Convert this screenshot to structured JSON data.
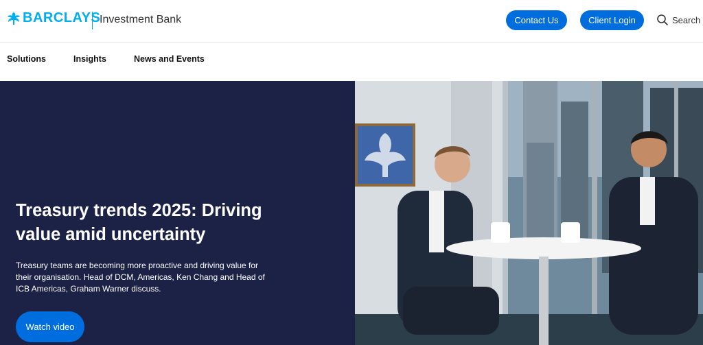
{
  "header": {
    "brand": "BARCLAYS",
    "unit": "Investment Bank",
    "contact_label": "Contact Us",
    "login_label": "Client Login",
    "search_label": "Search"
  },
  "nav": {
    "items": [
      {
        "label": "Solutions"
      },
      {
        "label": "Insights"
      },
      {
        "label": "News and Events"
      }
    ]
  },
  "hero": {
    "title": "Treasury trends 2025: Driving value amid uncertainty",
    "description": "Treasury teams are becoming more proactive and driving value for their organisation. Head of DCM, Americas, Ken Chang and Head of ICB Americas, Graham Warner discuss.",
    "cta_label": "Watch video"
  },
  "colors": {
    "brand_cyan": "#00aeef",
    "button_blue": "#006ddf",
    "hero_navy": "#1c2146"
  },
  "icons": [
    "eagle-logo-icon",
    "search-icon"
  ]
}
